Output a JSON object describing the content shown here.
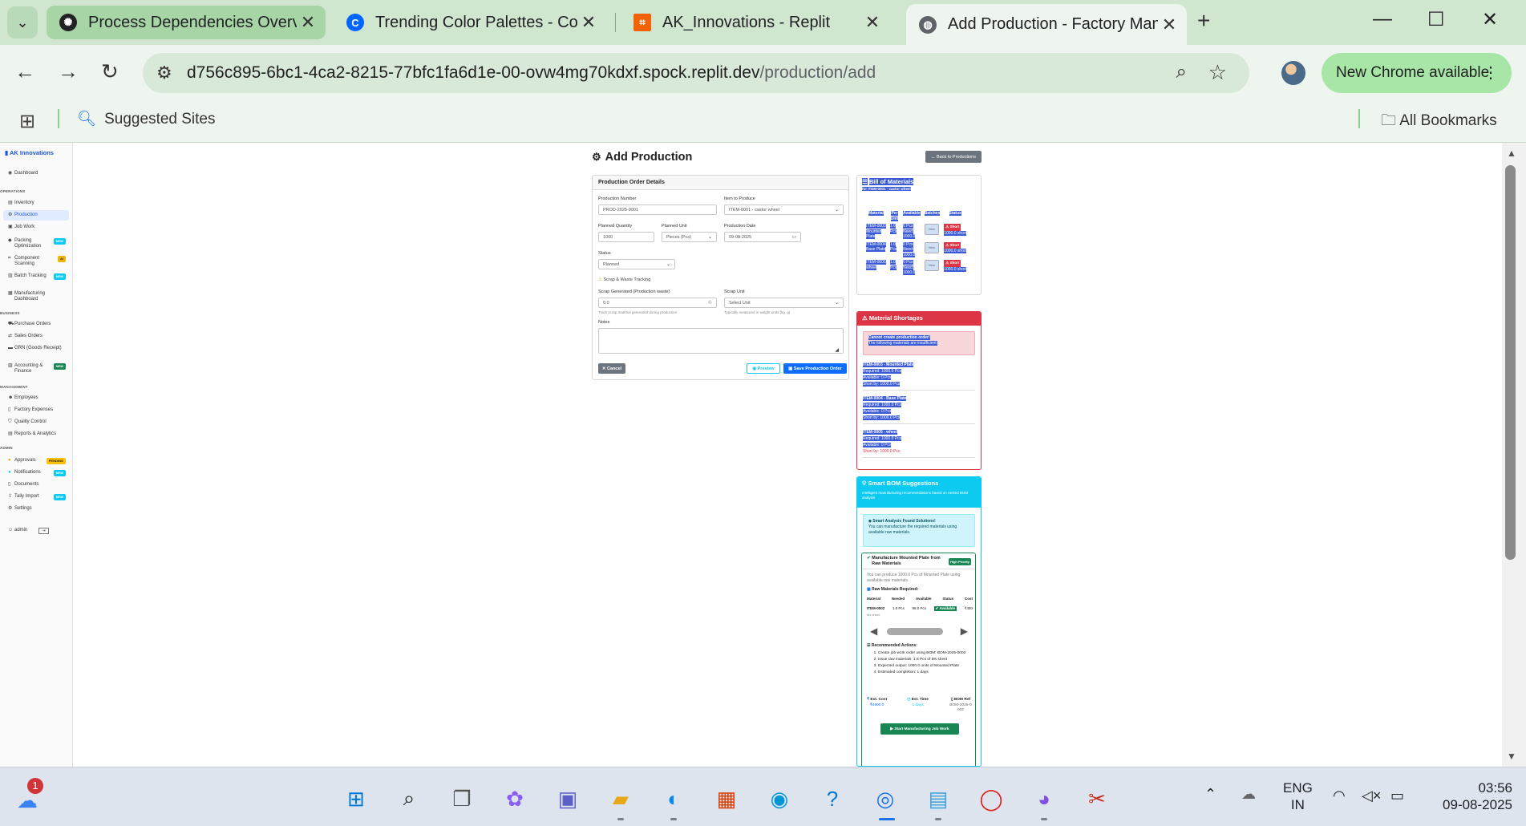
{
  "browser": {
    "tabs": [
      {
        "title": "Process Dependencies Overview",
        "favicon": "openai-icon"
      },
      {
        "title": "Trending Color Palettes - Coolors",
        "favicon": "coolors-icon"
      },
      {
        "title": "AK_Innovations - Replit",
        "favicon": "replit-icon"
      },
      {
        "title": "Add Production - Factory Management",
        "favicon": "globe-icon"
      }
    ],
    "url_host": "d756c895-6bc1-4ca2-8215-77bfc1fa6d1e-00-ovw4mg70kdxf.spock.replit.dev",
    "url_path": "/production/add",
    "new_chrome": "New Chrome available",
    "bookmarks": {
      "suggested": "Suggested Sites",
      "all": "All Bookmarks"
    }
  },
  "sidebar": {
    "brand": "AK Innovations",
    "sections": [
      "OPERATIONS",
      "BUSINESS",
      "MANAGEMENT",
      "ADMIN"
    ],
    "items": [
      {
        "label": "Dashboard"
      },
      {
        "label": "Inventory"
      },
      {
        "label": "Production"
      },
      {
        "label": "Job Work"
      },
      {
        "label": "Packing Optimization",
        "badge": "NEW"
      },
      {
        "label": "Component Scanning",
        "badge": "AI"
      },
      {
        "label": "Batch Tracking",
        "badge": "NEW"
      },
      {
        "label": "Manufacturing Dashboard"
      },
      {
        "label": "Purchase Orders"
      },
      {
        "label": "Sales Orders"
      },
      {
        "label": "GRN (Goods Receipt)"
      },
      {
        "label": "Accounting & Finance",
        "badge": "NEW"
      },
      {
        "label": "Employees"
      },
      {
        "label": "Factory Expenses"
      },
      {
        "label": "Quality Control"
      },
      {
        "label": "Reports & Analytics"
      },
      {
        "label": "Approvals",
        "badge": "PENDING"
      },
      {
        "label": "Notifications",
        "badge": "NEW"
      },
      {
        "label": "Documents"
      },
      {
        "label": "Tally Import",
        "badge": "NEW"
      },
      {
        "label": "Settings"
      },
      {
        "label": "admin"
      }
    ]
  },
  "page": {
    "title": "Add Production",
    "back_label": "← Back to Productions",
    "form": {
      "card_title": "Production Order Details",
      "production_number_label": "Production Number",
      "production_number": "PROD-2025-0001",
      "item_label": "Item to Produce",
      "item": "ITEM-0001 - castor wheel",
      "planned_qty_label": "Planned Quantity",
      "planned_qty": "1000",
      "planned_unit_label": "Planned Unit",
      "planned_unit": "Pieces (Pcs)",
      "date_label": "Production Date",
      "date": "09-08-2025",
      "status_label": "Status",
      "status": "Planned",
      "scrap_heading": "Scrap & Waste Tracking",
      "scrap_gen_label": "Scrap Generated (Production waste)",
      "scrap_gen": "0.0",
      "scrap_gen_hint": "Track scrap material generated during production",
      "scrap_unit_label": "Scrap Unit",
      "scrap_unit": "Select Unit",
      "scrap_unit_hint": "Typically measured in weight units (kg, g)",
      "notes_label": "Notes",
      "cancel": "Cancel",
      "preview": "Preview",
      "save": "Save Production Order"
    },
    "bom": {
      "title": "Bill of Materials",
      "subtitle": "for ITEM-0001 - castor wheel",
      "headers": [
        "Material",
        "Per Unit",
        "Available",
        "Batches",
        "Status"
      ],
      "rows": [
        {
          "material": "ITEM-0003 Mounted Plate",
          "per_unit": "1.0 Pcs",
          "available": "0 Pcs Need: 1000.0",
          "batches": "View",
          "status": "Short",
          "status_detail": "1000.0 short"
        },
        {
          "material": "ITEM-0004 Base Plate",
          "per_unit": "1.0 Pcs",
          "available": "0 Pcs Need: 1000.0",
          "batches": "View",
          "status": "Short",
          "status_detail": "1000.0 short"
        },
        {
          "material": "ITEM-0005 wheel",
          "per_unit": "1.0 Pcs",
          "available": "0 Pcs Need: 1000.0",
          "batches": "View",
          "status": "Short",
          "status_detail": "1000.0 short"
        }
      ]
    },
    "shortages": {
      "title": "Material Shortages",
      "alert_title": "Cannot create production order!",
      "alert_text": "The following materials are insufficient:",
      "items": [
        {
          "name": "ITEM-0003 - Mounted Plate",
          "required": "Required: 1000.0 Pcs",
          "available": "Available: 0 Pcs",
          "short": "Short by: 1000.0 Pcs"
        },
        {
          "name": "ITEM-0004 - Base Plate",
          "required": "Required: 1000.0 Pcs",
          "available": "Available: 0 Pcs",
          "short": "Short by: 1000.0 Pcs"
        },
        {
          "name": "ITEM-0005 - wheel",
          "required": "Required: 1000.0 Pcs",
          "available": "Available: 0 Pcs",
          "short": "Short by: 1000.0 Pcs"
        }
      ]
    },
    "smart_bom": {
      "title": "Smart BOM Suggestions",
      "subtitle": "Intelligent manufacturing recommendations based on nested BOM analysis",
      "info_title": "Smart Analysis Found Solutions!",
      "info_text": "You can manufacture the required materials using available raw materials.",
      "suggestion_title": "Manufacture Mounted Plate from Raw Materials",
      "priority": "High Priority",
      "suggestion_text": "You can produce 1000.0 Pcs of Mounted Plate using available raw materials.",
      "raw_heading": "Raw Materials Required:",
      "raw_headers": [
        "Material",
        "Needed",
        "Available",
        "Status",
        "Cost"
      ],
      "raw_row": {
        "material": "ITEM-0002",
        "material_sub": "Ms sheet",
        "needed": "1.6 Pcs",
        "available": "98.0 Pcs",
        "status": "Available",
        "cost": "₹480"
      },
      "actions_heading": "Recommended Actions:",
      "actions": [
        "Create job work order using BOM: BOM-2025-0002",
        "Issue raw materials: 1.6 Pcs of Ms sheet",
        "Expected output: 1000.0 units of Mounted Plate",
        "Estimated completion: 1 days"
      ],
      "est_cost_label": "Est. Cost",
      "est_cost": "₹4800.0",
      "est_time_label": "Est. Time",
      "est_time": "1 days",
      "bom_ref_label": "BOM Ref",
      "bom_ref": "BOM-2025-0002",
      "start_btn": "Start Manufacturing Job Work"
    }
  },
  "taskbar": {
    "notification_count": "1",
    "lang": "ENG",
    "region": "IN",
    "time": "03:56",
    "date": "09-08-2025"
  }
}
